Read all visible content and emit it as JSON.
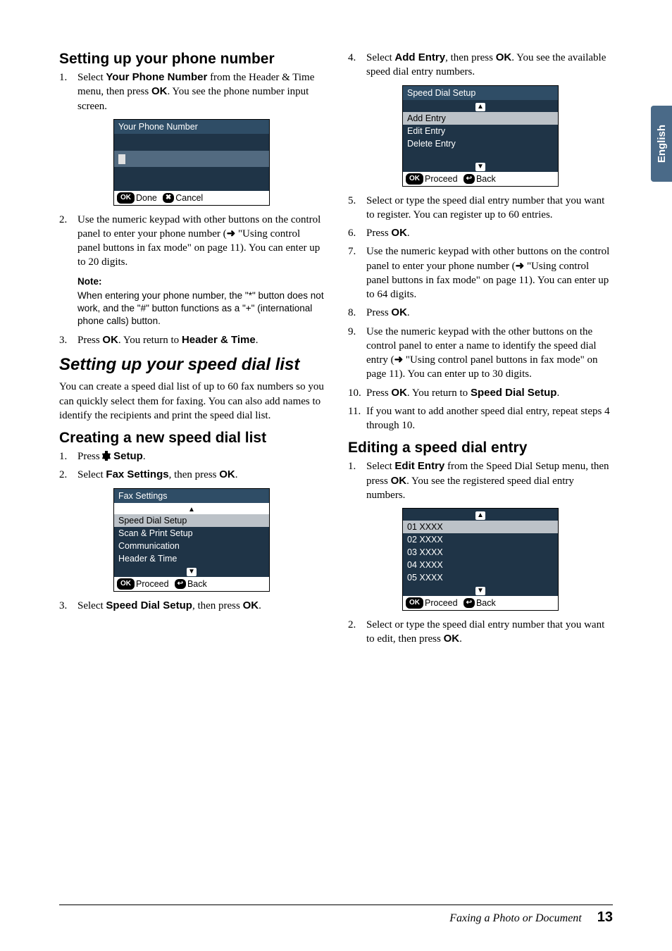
{
  "sidetab": "English",
  "footer": {
    "section": "Faxing a Photo or Document",
    "page": "13"
  },
  "glyphs": {
    "arrow_right": "➜",
    "ok": "OK",
    "tri_up": "▲",
    "tri_down": "▼"
  },
  "left": {
    "h_phone": "Setting up your phone number",
    "p1": {
      "num": "1.",
      "a": "Select ",
      "b": "Your Phone Number",
      "c": " from the Header & Time menu, then press ",
      "d": "OK",
      "e": ". You see the phone number input screen."
    },
    "screen1": {
      "title": "Your Phone Number",
      "status_ok": "OK",
      "status_done": "Done",
      "status_cancel": "Cancel"
    },
    "p2": {
      "num": "2.",
      "a": "Use the numeric keypad with other buttons on the control panel to enter your phone number (",
      "b": " \"Using control panel buttons in fax mode\" on page 11). You can enter up to 20 digits."
    },
    "note": {
      "head": "Note:",
      "body": "When entering your phone number, the \"*\" button does not work, and the \"#\" button functions as a \"+\" (international phone calls) button."
    },
    "p3": {
      "num": "3.",
      "a": "Press ",
      "b": "OK",
      "c": ". You return to ",
      "d": "Header & Time",
      "e": "."
    },
    "h_speed": "Setting up your speed dial list",
    "speed_intro": "You can create a speed dial list of up to 60 fax numbers so you can quickly select them for faxing. You can also add names to identify the recipients and print the speed dial list.",
    "h_create": "Creating a new speed dial list",
    "c1": {
      "num": "1.",
      "a": "Press ",
      "b": "Setup",
      "c": "."
    },
    "c2": {
      "num": "2.",
      "a": "Select ",
      "b": "Fax Settings",
      "c": ", then press ",
      "d": "OK",
      "e": "."
    },
    "screen2": {
      "title": "Fax Settings",
      "r1": "Speed Dial Setup",
      "r2": "Scan & Print Setup",
      "r3": "Communication",
      "r4": "Header & Time",
      "proceed": "Proceed",
      "back": "Back"
    },
    "c3": {
      "num": "3.",
      "a": "Select ",
      "b": "Speed Dial Setup",
      "c": ", then press ",
      "d": "OK",
      "e": "."
    }
  },
  "right": {
    "r4": {
      "num": "4.",
      "a": "Select ",
      "b": "Add Entry",
      "c": ", then press ",
      "d": "OK",
      "e": ". You see the available speed dial entry numbers."
    },
    "screen3": {
      "title": "Speed Dial Setup",
      "r1": "Add Entry",
      "r2": "Edit Entry",
      "r3": "Delete Entry",
      "proceed": "Proceed",
      "back": "Back"
    },
    "r5": {
      "num": "5.",
      "a": "Select or type the speed dial entry number that you want to register. You can register up to 60 entries."
    },
    "r6": {
      "num": "6.",
      "a": "Press ",
      "b": "OK",
      "c": "."
    },
    "r7": {
      "num": "7.",
      "a": "Use the numeric keypad with other buttons on the control panel to enter your phone number (",
      "b": " \"Using control panel buttons in fax mode\" on page 11). You can enter up to 64 digits."
    },
    "r8": {
      "num": "8.",
      "a": "Press ",
      "b": "OK",
      "c": "."
    },
    "r9": {
      "num": "9.",
      "a": "Use the numeric keypad with the other buttons on the control panel to enter a name to identify the speed dial entry (",
      "b": " \"Using control panel buttons in fax mode\" on page 11). You can enter up to 30 digits."
    },
    "r10": {
      "num": "10.",
      "a": "Press ",
      "b": "OK",
      "c": ". You return to ",
      "d": "Speed Dial Setup",
      "e": "."
    },
    "r11": {
      "num": "11.",
      "a": "If you want to add another speed dial entry, repeat steps 4 through 10."
    },
    "h_edit": "Editing a speed dial entry",
    "e1": {
      "num": "1.",
      "a": "Select ",
      "b": "Edit Entry",
      "c": " from the Speed Dial Setup menu, then press ",
      "d": "OK",
      "e": ". You see the registered speed dial entry numbers."
    },
    "screen4": {
      "r1": "01  XXXX",
      "r2": "02  XXXX",
      "r3": "03  XXXX",
      "r4": "04  XXXX",
      "r5": "05  XXXX",
      "proceed": "Proceed",
      "back": "Back"
    },
    "e2": {
      "num": "2.",
      "a": "Select or type the speed dial entry number that you want to edit, then press ",
      "b": "OK",
      "c": "."
    }
  }
}
